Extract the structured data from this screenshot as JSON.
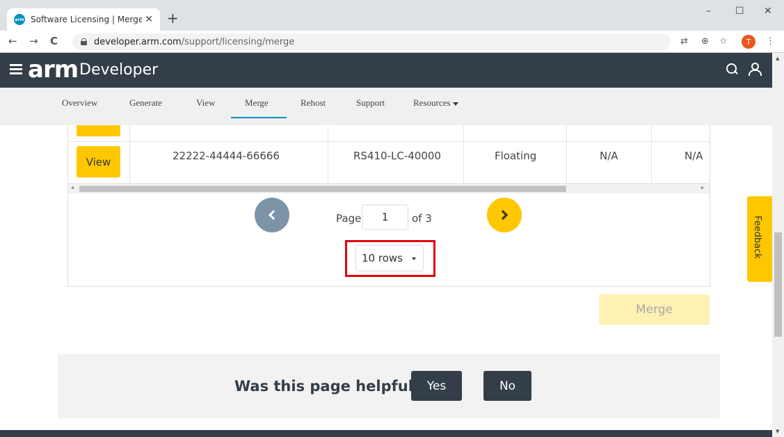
{
  "browser": {
    "tab_title": "Software Licensing | Merge – Arm",
    "favicon_text": "arm",
    "tab_close": "✕",
    "new_tab": "+",
    "win_minimize": "–",
    "win_maximize": "☐",
    "win_close": "✕",
    "url_host": "developer.arm.com",
    "url_path": "/support/licensing/merge",
    "profile_initial": "T",
    "nav_back": "←",
    "nav_forward": "→",
    "nav_reload": "C",
    "translate_icon": "⇄",
    "zoom_icon": "⊕",
    "star_icon": "☆",
    "menu_icon": "⋮"
  },
  "header": {
    "logo": "arm",
    "product": "Developer"
  },
  "subnav": {
    "items": [
      "Overview",
      "Generate",
      "View",
      "Merge",
      "Rehost",
      "Support",
      "Resources"
    ],
    "active": "Merge"
  },
  "table": {
    "row": {
      "view_label": "View",
      "serial": "22222-44444-66666",
      "product_code": "RS410-LC-40000",
      "type": "Floating",
      "col5": "N/A",
      "col6": "N/A"
    },
    "scroll_left": "◂",
    "scroll_right": "▸"
  },
  "pager": {
    "page_label": "Page",
    "current_page": "1",
    "of_label": "of 3",
    "rows_value": "10 rows"
  },
  "merge_label": "Merge",
  "feedback_label": "Feedback",
  "helpful": {
    "question": "Was this page helpful?",
    "yes": "Yes",
    "no": "No"
  },
  "scrollbar": {
    "up": "▲",
    "down": "▼"
  },
  "colors": {
    "accent_yellow": "#ffc700",
    "header_dark": "#333e48",
    "highlight_red": "#e0000b",
    "active_underline": "#0091bd"
  }
}
